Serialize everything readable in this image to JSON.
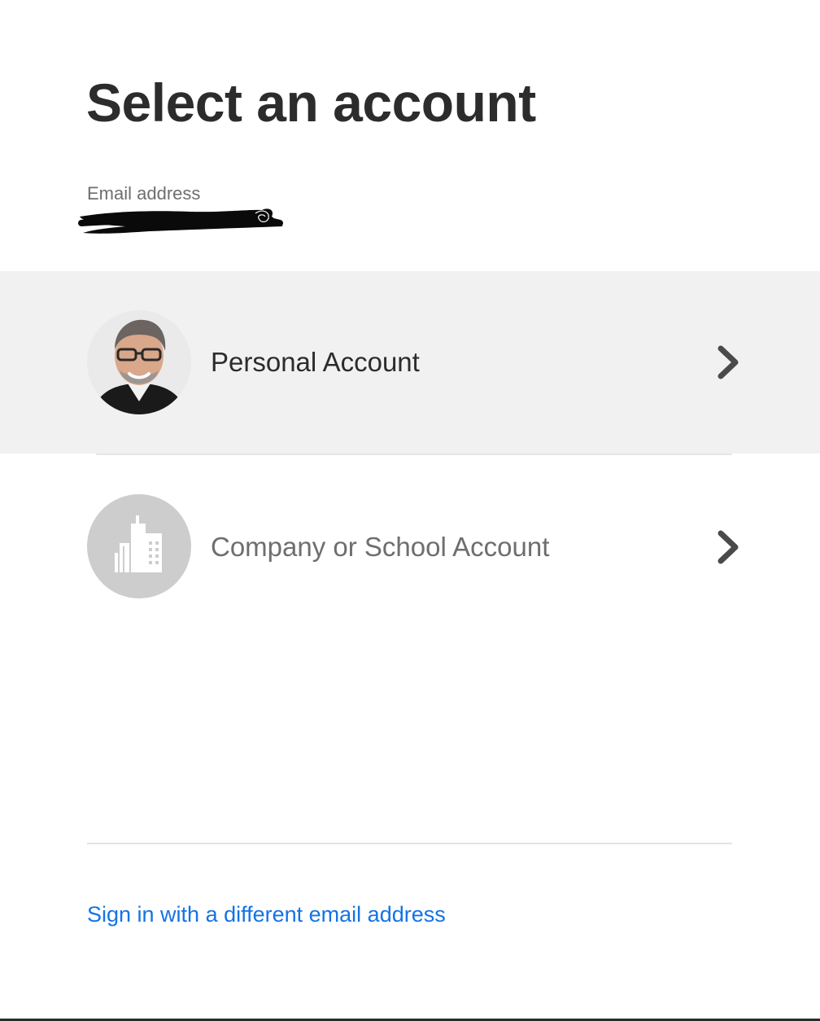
{
  "page": {
    "title": "Select an account"
  },
  "email": {
    "label": "Email address",
    "value_redacted": true
  },
  "accounts": [
    {
      "label": "Personal Account",
      "avatar": "user-photo",
      "icon": "chevron-right-icon",
      "selected": true
    },
    {
      "label": "Company or School Account",
      "avatar": "building-icon",
      "icon": "chevron-right-icon",
      "selected": false
    }
  ],
  "footer": {
    "alt_signin_label": "Sign in with a different email address"
  },
  "colors": {
    "text_primary": "#2c2c2c",
    "text_secondary": "#6e6e6e",
    "link": "#1473e6",
    "selected_row_bg": "#f1f1f1",
    "building_avatar_bg": "#cdcdcd"
  }
}
